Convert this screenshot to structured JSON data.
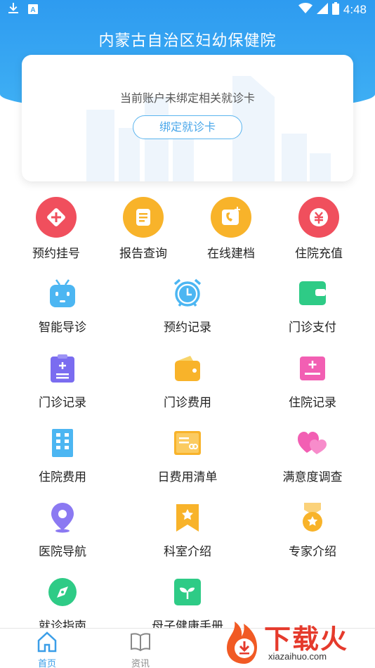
{
  "statusbar": {
    "time": "4:48"
  },
  "header": {
    "title": "内蒙古自治区妇幼保健院"
  },
  "card": {
    "message": "当前账户未绑定相关就诊卡",
    "bind_button": "绑定就诊卡"
  },
  "quick": [
    {
      "label": "预约挂号",
      "icon": "plus-tag-icon",
      "color": "#f04f5d"
    },
    {
      "label": "报告查询",
      "icon": "report-doc-icon",
      "color": "#f8b32a"
    },
    {
      "label": "在线建档",
      "icon": "file-create-icon",
      "color": "#f8b32a"
    },
    {
      "label": "住院充值",
      "icon": "yuan-coin-icon",
      "color": "#f04f5d"
    }
  ],
  "grid": [
    {
      "label": "智能导诊",
      "icon": "robot-icon",
      "color": "#4cb6f2"
    },
    {
      "label": "预约记录",
      "icon": "alarm-clock-icon",
      "color": "#4cb6f2"
    },
    {
      "label": "门诊支付",
      "icon": "wallet-icon",
      "color": "#2ecb86"
    },
    {
      "label": "门诊记录",
      "icon": "clipboard-icon",
      "color": "#7a6cf0"
    },
    {
      "label": "门诊费用",
      "icon": "purse-icon",
      "color": "#f8b32a"
    },
    {
      "label": "住院记录",
      "icon": "record-card-icon",
      "color": "#f25fb3"
    },
    {
      "label": "住院费用",
      "icon": "building-icon",
      "color": "#4cb6f2"
    },
    {
      "label": "日费用清单",
      "icon": "bill-icon",
      "color": "#f8b32a"
    },
    {
      "label": "满意度调查",
      "icon": "hearts-icon",
      "color": "#f25fb3"
    },
    {
      "label": "医院导航",
      "icon": "location-pin-icon",
      "color": "#8b79f2"
    },
    {
      "label": "科室介绍",
      "icon": "bookmark-star-icon",
      "color": "#f8b32a"
    },
    {
      "label": "专家介绍",
      "icon": "medal-icon",
      "color": "#f8b32a"
    },
    {
      "label": "就诊指南",
      "icon": "compass-icon",
      "color": "#2ecb86"
    },
    {
      "label": "母子健康手册",
      "icon": "sprout-icon",
      "color": "#2ecb86"
    }
  ],
  "nav": [
    {
      "label": "首页",
      "icon": "home-icon",
      "active": true
    },
    {
      "label": "资讯",
      "icon": "book-icon",
      "active": false
    }
  ],
  "watermark": {
    "text": "下载火",
    "sub": "xiazaihuo.com"
  },
  "colors": {
    "primary": "#3ea8f2",
    "active_nav": "#3a9ee8"
  }
}
